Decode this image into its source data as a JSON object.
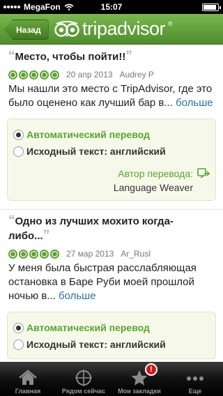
{
  "status_bar": {
    "carrier": "MegaFon",
    "time": "15:07",
    "battery_level": 0.92
  },
  "nav": {
    "back_label": "Назад",
    "logo_text": "tripadvisor",
    "logo_mark": "®",
    "brand_color": "#5a9a35"
  },
  "reviews": [
    {
      "title": "Место, чтобы пойти!!",
      "rating": 5,
      "date": "20 апр 2013",
      "author": "Audrey P",
      "text": "Мы нашли это место с TripAdvisor, где это было оценено как лучший бар в...",
      "more": "больше"
    },
    {
      "title": "Одно из лучших мохито когда-либо...",
      "rating": 5,
      "date": "27 мар 2013",
      "author": "Ar_Rusl",
      "text": "У меня была быстрая расслабляющая остановка в Баре Руби моей прошлой ночью в...",
      "more": "больше"
    }
  ],
  "translation": {
    "auto_label": "Автоматический перевод",
    "source_label": "Исходный текст: английский",
    "credit_label": "Автор перевода:",
    "credit_name": "Language Weaver",
    "credit_icon": "translate-icon"
  },
  "tabs": [
    {
      "label": "Главная",
      "icon": "home-icon"
    },
    {
      "label": "Рядом сейчас",
      "icon": "crosshair-icon"
    },
    {
      "label": "Мои закладки",
      "icon": "star-icon",
      "badge": "!"
    },
    {
      "label": "Еще",
      "icon": "more-icon"
    }
  ]
}
